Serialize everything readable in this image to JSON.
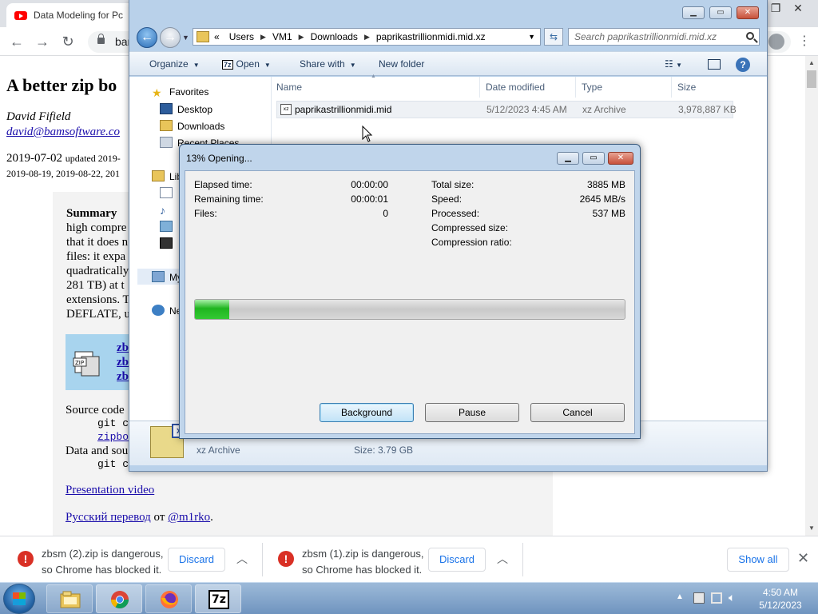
{
  "browser": {
    "tab_title": "Data Modeling for Pc",
    "url": "bam",
    "page": {
      "heading": "A better zip bo",
      "author": "David Fifield",
      "email": "david@bamsoftware.co",
      "date": "2019-07-02",
      "updated": "updated 2019-",
      "dates_line2": "2019-08-19, 2019-08-22, 201",
      "summary_label": "Summary",
      "summary_lines": [
        "high compre",
        "that it does n",
        "files: it expa",
        "quadratically",
        "281 TB) at t",
        "extensions. T",
        "DEFLATE, u"
      ],
      "zbsm_links": [
        "zbs",
        "zbs",
        "zbs"
      ],
      "source_code": "Source code",
      "git_clone_1": "git cl",
      "zipbomb_link": "zipbon",
      "data_and_source": "Data and sou",
      "git_clone_2": "git cl",
      "presentation_video": "Presentation video",
      "russian_translation": "Русский перевод",
      "ot": "от",
      "translator": "@m1rko",
      "period": "."
    }
  },
  "downloads": [
    {
      "message_line1": "zbsm (2).zip is dangerous,",
      "message_line2": "so Chrome has blocked it.",
      "discard_label": "Discard"
    },
    {
      "message_line1": "zbsm (1).zip is dangerous,",
      "message_line2": "so Chrome has blocked it.",
      "discard_label": "Discard"
    }
  ],
  "show_all_label": "Show all",
  "explorer": {
    "breadcrumbs": [
      "«",
      "Users",
      "VM1",
      "Downloads",
      "paprikastrillionmidi.mid.xz"
    ],
    "search_placeholder": "Search paprikastrillionmidi.mid.xz",
    "commands": {
      "organize": "Organize",
      "open": "Open",
      "share_with": "Share with",
      "new_folder": "New folder"
    },
    "nav": {
      "favorites": "Favorites",
      "desktop": "Desktop",
      "downloads": "Downloads",
      "recent_places": "Recent Places",
      "libraries": "Lib",
      "my": "My",
      "network": "Ne"
    },
    "columns": {
      "name": "Name",
      "date_modified": "Date modified",
      "type": "Type",
      "size": "Size"
    },
    "files": [
      {
        "name": "paprikastrillionmidi.mid",
        "date": "5/12/2023 4:45 AM",
        "type": "xz Archive",
        "size": "3,978,887 KB"
      }
    ],
    "details": {
      "type": "xz Archive",
      "size": "Size: 3.79 GB"
    }
  },
  "dialog": {
    "title": "13% Opening...",
    "progress_fraction": 0.08,
    "left_stats": [
      {
        "label": "Elapsed time:",
        "value": "00:00:00"
      },
      {
        "label": "Remaining time:",
        "value": "00:00:01"
      },
      {
        "label": "Files:",
        "value": "0"
      }
    ],
    "right_stats": [
      {
        "label": "Total size:",
        "value": "3885 MB"
      },
      {
        "label": "Speed:",
        "value": "2645 MB/s"
      },
      {
        "label": "Processed:",
        "value": "537 MB"
      },
      {
        "label": "Compressed size:",
        "value": ""
      },
      {
        "label": "Compression ratio:",
        "value": ""
      }
    ],
    "buttons": {
      "background": "Background",
      "pause": "Pause",
      "cancel": "Cancel"
    }
  },
  "taskbar": {
    "time": "4:50 AM",
    "date": "5/12/2023",
    "apps": [
      "explorer",
      "chrome",
      "firefox",
      "7zip"
    ],
    "sevenzip_label": "7z"
  }
}
